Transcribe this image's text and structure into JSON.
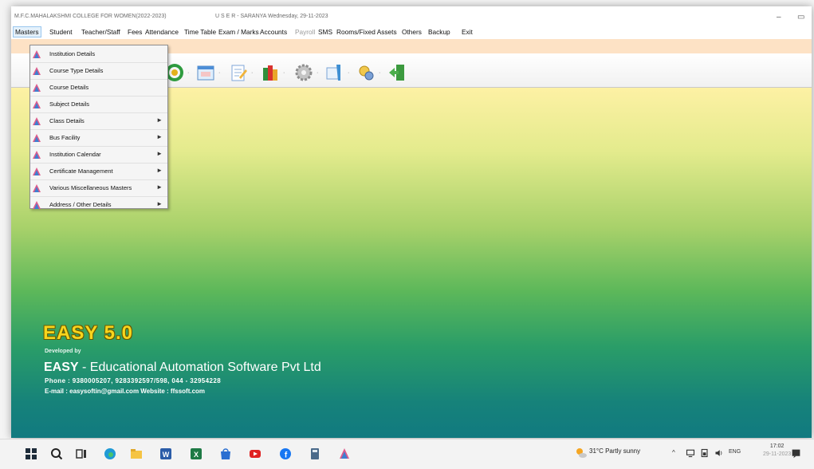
{
  "window": {
    "title_left": "M.F.C.MAHALAKSHMI COLLEGE FOR WOMEN(2022-2023)",
    "title_right": "U S E R - SARANYA    Wednesday, 29-11-2023",
    "controls": {
      "minimize": "–",
      "maximize": "▭"
    }
  },
  "menu": [
    {
      "label": "Masters",
      "active": true
    },
    {
      "label": "Student"
    },
    {
      "label": "Teacher/Staff"
    },
    {
      "label": "Fees"
    },
    {
      "label": "Attendance"
    },
    {
      "label": "Time Table"
    },
    {
      "label": "Exam / Marks"
    },
    {
      "label": "Accounts"
    },
    {
      "label": "Payroll",
      "disabled": true
    },
    {
      "label": "SMS"
    },
    {
      "label": "Rooms/Fixed Assets"
    },
    {
      "label": "Others"
    },
    {
      "label": "Backup"
    },
    {
      "label": "Exit"
    }
  ],
  "toolbar": {
    "icons": [
      "student-icon",
      "calendar-icon",
      "notepad-icon",
      "books-icon",
      "gear-icon",
      "report-icon",
      "tools-icon",
      "exit-door-icon"
    ],
    "arrow": "·"
  },
  "dropdown": {
    "items": [
      {
        "label": "Institution Details",
        "submenu": false
      },
      {
        "label": "Course Type Details",
        "submenu": false
      },
      {
        "label": "Course Details",
        "submenu": false
      },
      {
        "label": "Subject Details",
        "submenu": false
      },
      {
        "label": "Class Details",
        "submenu": true
      },
      {
        "label": "Bus Facility",
        "submenu": true
      },
      {
        "label": "Institution Calendar",
        "submenu": true
      },
      {
        "label": "Certificate Management",
        "submenu": true
      },
      {
        "label": "Various Miscellaneous Masters",
        "submenu": true
      },
      {
        "label": "Address / Other Details",
        "submenu": true
      }
    ],
    "submenu_arrow": "►"
  },
  "brand": {
    "product": "EASY 5.0",
    "developed_by": "Developed by",
    "company_bold": "EASY",
    "company_rest": " - Educational Automation Software Pvt Ltd",
    "phone": "Phone : 9380005207, 9283392597/598,  044 - 32954228",
    "email": "E-mail : easysoftin@gmail.com      Website : ffssoft.com"
  },
  "taskbar": {
    "weather": "31°C  Partly sunny",
    "tray_caret": "^",
    "language": "ENG",
    "time": "17:02",
    "date": "29-11-2023"
  },
  "colors": {
    "peach_bar": "#fde2c5",
    "gradient_top": "#fdf1a4",
    "gradient_bottom": "#117a80",
    "title_yellow": "#f7d51d"
  }
}
